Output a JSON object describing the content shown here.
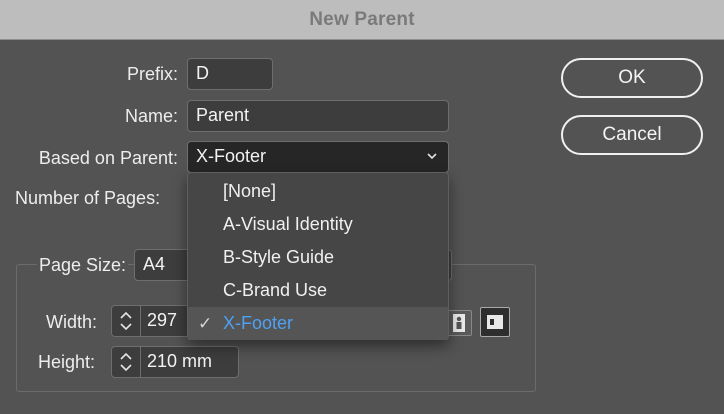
{
  "window": {
    "title": "New Parent"
  },
  "form": {
    "prefix_label": "Prefix:",
    "prefix_value": "D",
    "name_label": "Name:",
    "name_value": "Parent",
    "based_on_label": "Based on Parent:",
    "based_on_value": "X-Footer",
    "pages_label": "Number of Pages:",
    "page_size_label": "Page Size:",
    "page_size_value": "A4",
    "width_label": "Width:",
    "width_value": "297",
    "height_label": "Height:",
    "height_value": "210 mm"
  },
  "buttons": {
    "ok": "OK",
    "cancel": "Cancel"
  },
  "dropdown": {
    "items": [
      "[None]",
      "A-Visual Identity",
      "B-Style Guide",
      "C-Brand Use",
      "X-Footer"
    ],
    "selected_index": 4,
    "check_glyph": "✓",
    "selected_color": "#4ea1f3"
  },
  "icons": {
    "chevron": "chevron-down-icon",
    "stepper": "stepper-arrows-icon",
    "portrait": "portrait-orientation-icon",
    "landscape": "landscape-orientation-icon"
  }
}
